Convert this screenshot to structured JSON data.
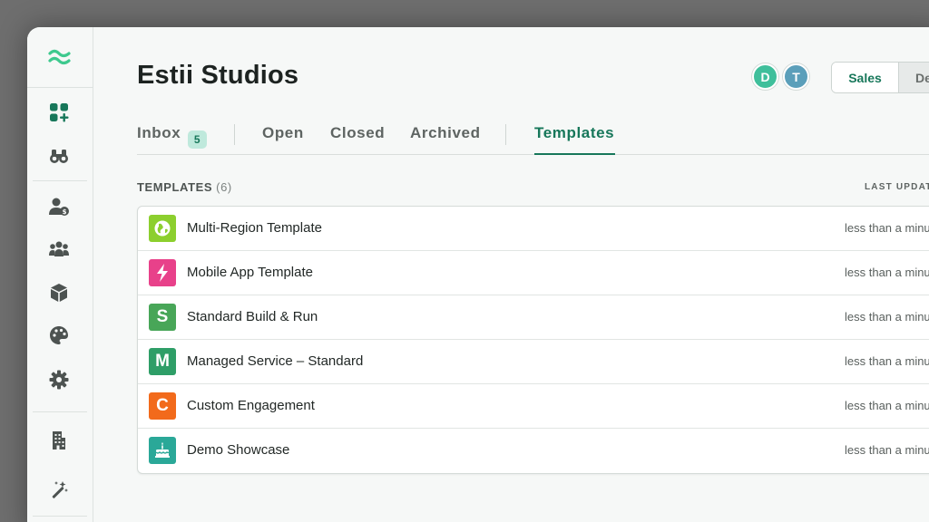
{
  "header": {
    "title": "Estii Studios",
    "avatars": [
      {
        "initial": "D",
        "color": "#3fbf9b"
      },
      {
        "initial": "T",
        "color": "#5b9fba"
      }
    ],
    "segment": {
      "active": "Sales",
      "other": "De"
    }
  },
  "tabs": {
    "inbox": {
      "label": "Inbox",
      "count": "5"
    },
    "open": "Open",
    "closed": "Closed",
    "archived": "Archived",
    "templates": "Templates",
    "active": "templates"
  },
  "section": {
    "title": "TEMPLATES",
    "count": "(6)",
    "column_header": "LAST UPDATED"
  },
  "templates": [
    {
      "name": "Multi-Region Template",
      "updated": "less than a minute ago",
      "icon": "globe-icon",
      "letter": "",
      "color": "#8ccf2e"
    },
    {
      "name": "Mobile App Template",
      "updated": "less than a minute ago",
      "icon": "lightning-icon",
      "letter": "",
      "color": "#e8418a"
    },
    {
      "name": "Standard Build & Run",
      "updated": "less than a minute ago",
      "icon": "letter-icon",
      "letter": "S",
      "color": "#48a658"
    },
    {
      "name": "Managed Service – Standard",
      "updated": "less than a minute ago",
      "icon": "letter-icon",
      "letter": "M",
      "color": "#2e9e67"
    },
    {
      "name": "Custom Engagement",
      "updated": "less than a minute ago",
      "icon": "letter-icon",
      "letter": "C",
      "color": "#f26a1b"
    },
    {
      "name": "Demo Showcase",
      "updated": "less than a minute ago",
      "icon": "cake-icon",
      "letter": "",
      "color": "#2aa898"
    }
  ],
  "sidebar": {
    "icons": [
      "logo-waves-icon",
      "grid-add-icon",
      "binoculars-icon",
      "user-dollar-icon",
      "users-icon",
      "box-icon",
      "palette-icon",
      "gear-icon",
      "building-icon",
      "magic-wand-icon"
    ]
  },
  "colors": {
    "accent": "#17775a",
    "badge_bg": "#bfe9dc"
  }
}
